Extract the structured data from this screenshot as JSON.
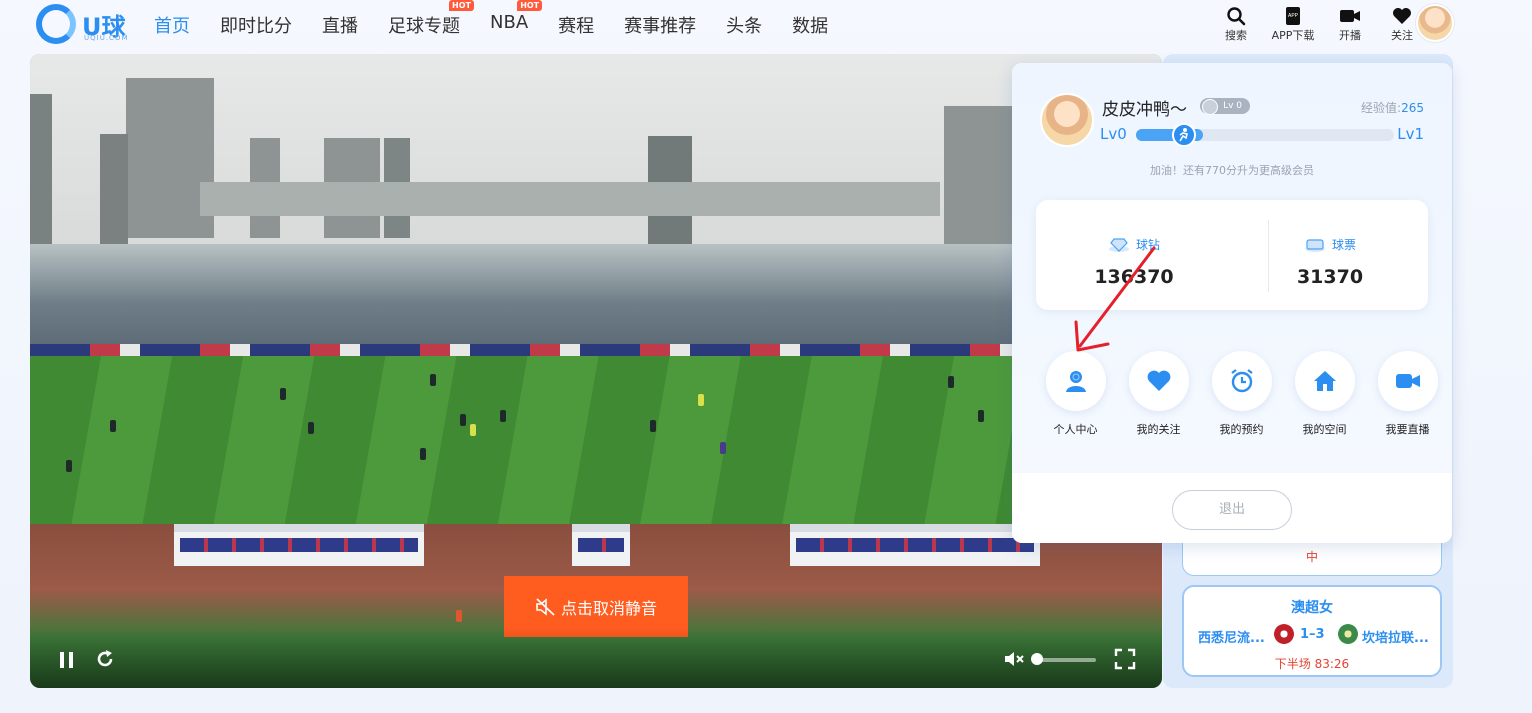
{
  "header": {
    "logo": {
      "name": "U球",
      "sub": "UQIU.COM"
    },
    "nav": [
      {
        "label": "首页",
        "active": true,
        "hot": false
      },
      {
        "label": "即时比分",
        "active": false,
        "hot": false
      },
      {
        "label": "直播",
        "active": false,
        "hot": false
      },
      {
        "label": "足球专题",
        "active": false,
        "hot": true
      },
      {
        "label": "NBA",
        "active": false,
        "hot": true
      },
      {
        "label": "赛程",
        "active": false,
        "hot": false
      },
      {
        "label": "赛事推荐",
        "active": false,
        "hot": false
      },
      {
        "label": "头条",
        "active": false,
        "hot": false
      },
      {
        "label": "数据",
        "active": false,
        "hot": false
      }
    ],
    "hot_label": "HOT",
    "tools": [
      {
        "label": "搜索",
        "icon": "search-icon"
      },
      {
        "label": "APP下载",
        "icon": "app-icon"
      },
      {
        "label": "开播",
        "icon": "camera-icon"
      },
      {
        "label": "关注",
        "icon": "heart-icon"
      }
    ]
  },
  "video": {
    "mute_label": "点击取消静音",
    "volume_level": 0.0
  },
  "popup": {
    "username": "皮皮冲鸭～",
    "level_badge": "Lv 0",
    "exp_label": "经验值:",
    "exp_value": "265",
    "level_from": "Lv0",
    "level_to": "Lv1",
    "progress": 0.26,
    "hint": "加油！还有770分升为更高级会员",
    "wallet": [
      {
        "label": "球钻",
        "value": "136370",
        "icon": "diamond-icon"
      },
      {
        "label": "球票",
        "value": "31370",
        "icon": "ticket-icon"
      }
    ],
    "menu": [
      {
        "label": "个人中心",
        "icon": "user-icon"
      },
      {
        "label": "我的关注",
        "icon": "heart-icon"
      },
      {
        "label": "我的预约",
        "icon": "alarm-icon"
      },
      {
        "label": "我的空间",
        "icon": "home-icon"
      },
      {
        "label": "我要直播",
        "icon": "video-icon"
      }
    ],
    "logout_label": "退出"
  },
  "sidebar": {
    "prev_status": "中",
    "match": {
      "league": "澳超女",
      "home": "西悉尼流...",
      "score": "1–3",
      "away": "坎培拉联...",
      "time": "下半场 83:26"
    }
  },
  "colors": {
    "accent": "#2b8ef0",
    "hot": "#ff5a3c",
    "mute": "#ff5c1f",
    "live_red": "#e3432f",
    "annotation_arrow": "#e5202a"
  }
}
